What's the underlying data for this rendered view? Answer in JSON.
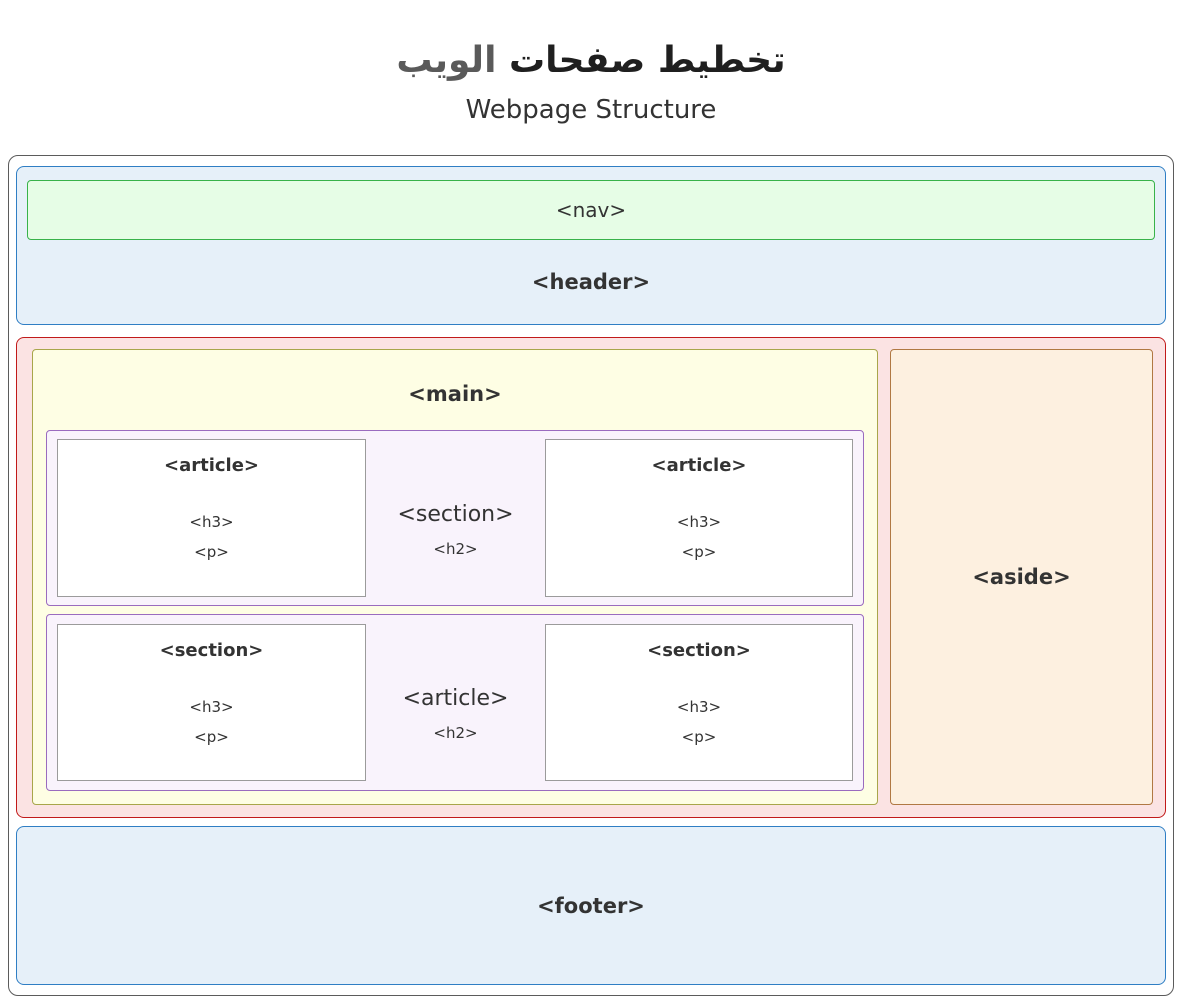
{
  "title": {
    "word1": "تخطيط صفحات",
    "word2": "الويب"
  },
  "subtitle": "Webpage Structure",
  "nav": "<nav>",
  "header": "<header>",
  "main": "<main>",
  "aside": "<aside>",
  "footer": "<footer>",
  "row1": {
    "left": {
      "title": "<article>",
      "heading": "<h3>",
      "para": "<p>"
    },
    "middle": {
      "title": "<section>",
      "heading": "<h2>"
    },
    "right": {
      "title": "<article>",
      "heading": "<h3>",
      "para": "<p>"
    }
  },
  "row2": {
    "left": {
      "title": "<section>",
      "heading": "<h3>",
      "para": "<p>"
    },
    "middle": {
      "title": "<article>",
      "heading": "<h2>"
    },
    "right": {
      "title": "<section>",
      "heading": "<h3>",
      "para": "<p>"
    }
  }
}
